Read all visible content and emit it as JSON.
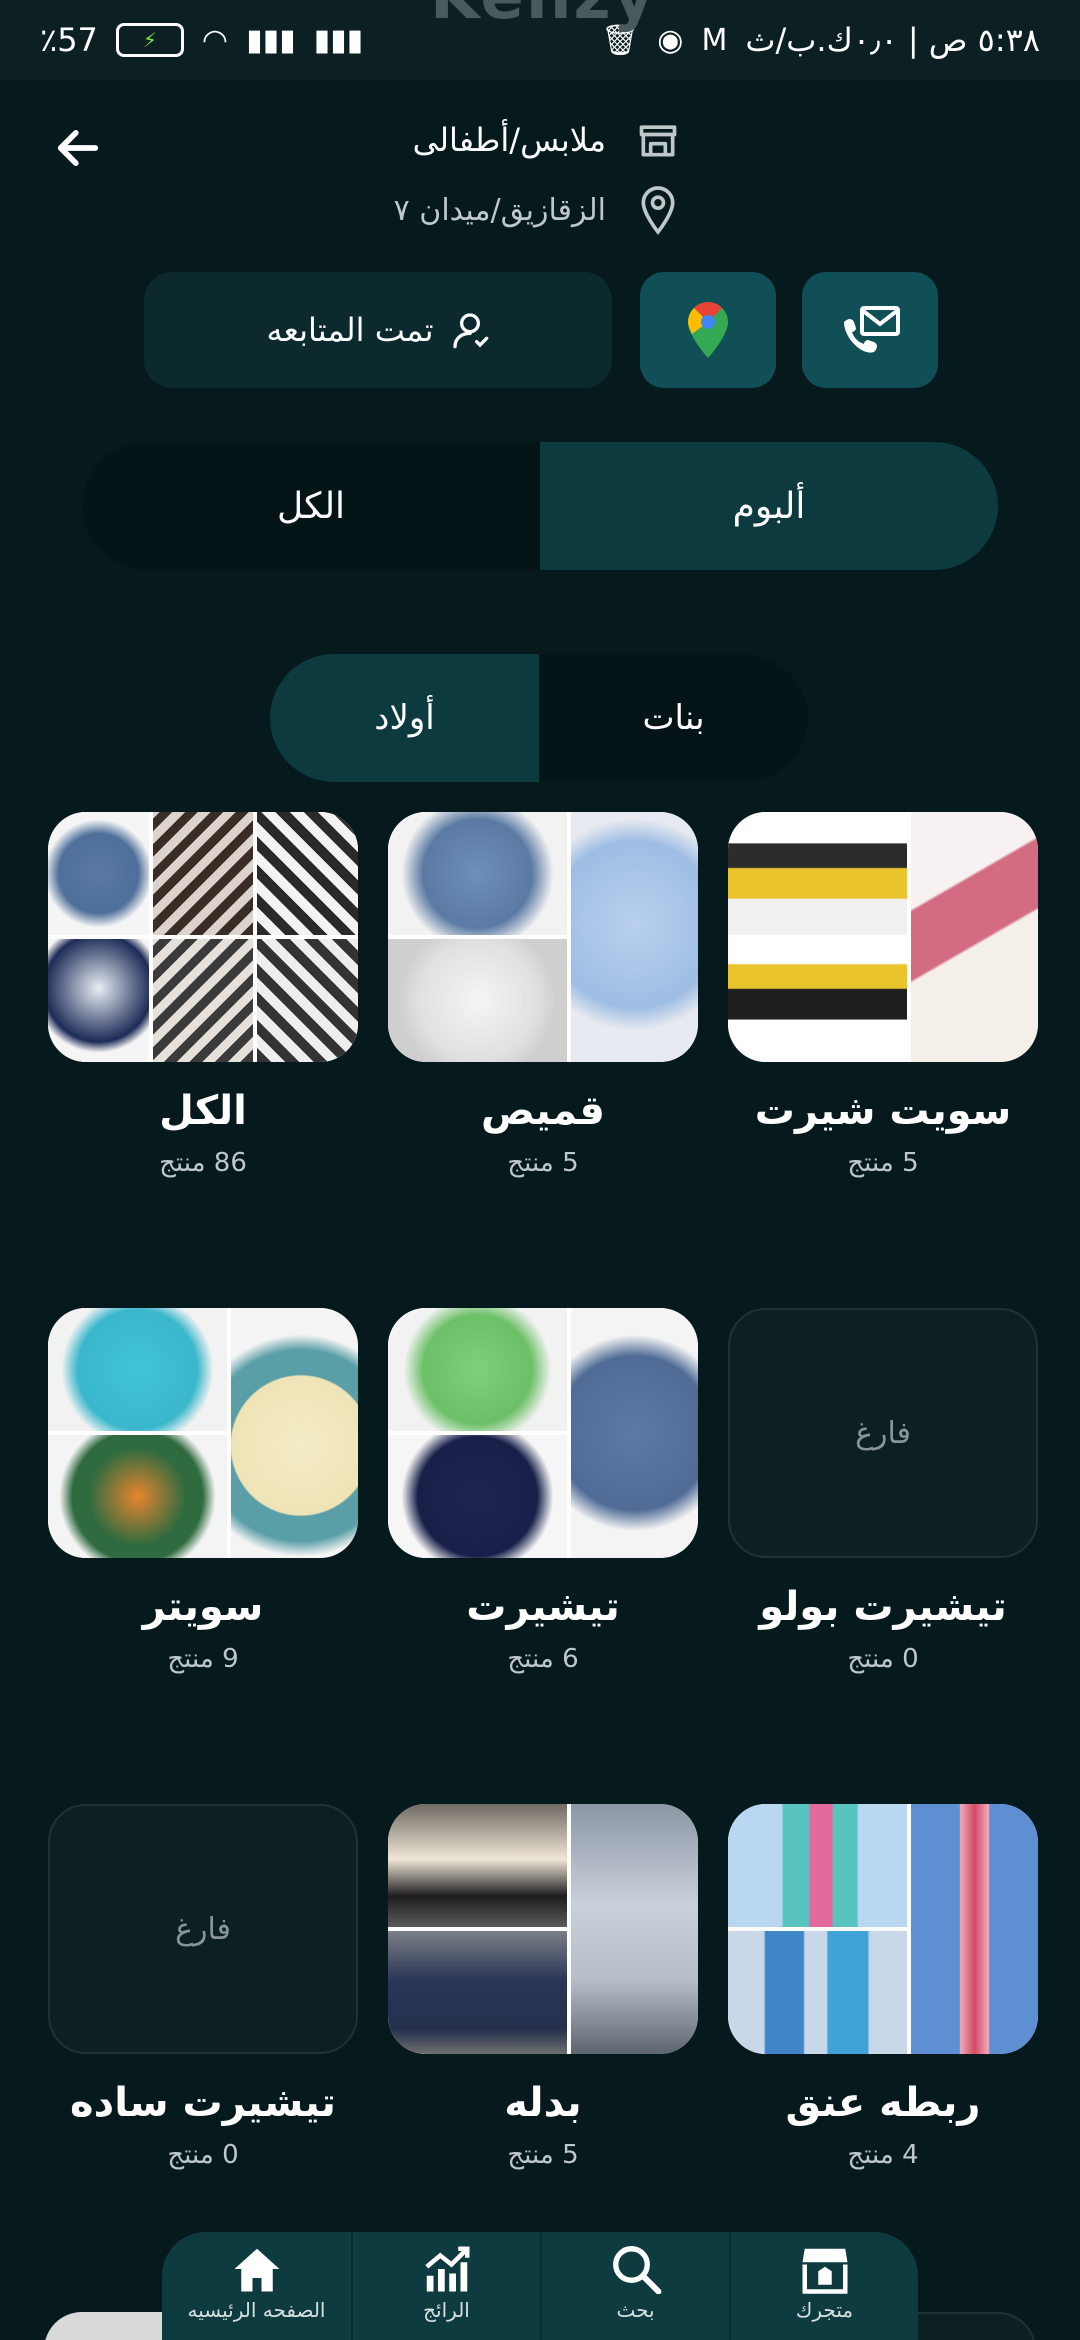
{
  "status_bar": {
    "time": "٥:٣٨ ص | ٠٫٠ك.ب/ث",
    "battery": "٪57"
  },
  "app_title_ghost": "Kenzy",
  "store": {
    "category": "ملابس/أطفالى",
    "location": "الزقازيق/ميدان ٧"
  },
  "actions": {
    "follow_label": "تمت المتابعه"
  },
  "main_tabs": [
    {
      "label": "ألبوم",
      "active": true
    },
    {
      "label": "الكل",
      "active": false
    }
  ],
  "sub_tabs": [
    {
      "label": "بنات",
      "active": false
    },
    {
      "label": "أولاد",
      "active": true
    }
  ],
  "categories": [
    {
      "title": "سويت شيرت",
      "count": "5 منتج",
      "empty": false
    },
    {
      "title": "قميص",
      "count": "5 منتج",
      "empty": false
    },
    {
      "title": "الكل",
      "count": "86 منتج",
      "empty": false
    },
    {
      "title": "تيشيرت بولو",
      "count": "0 منتج",
      "empty": true,
      "empty_label": "فارغ"
    },
    {
      "title": "تيشيرت",
      "count": "6 منتج",
      "empty": false
    },
    {
      "title": "سويتر",
      "count": "9 منتج",
      "empty": false
    },
    {
      "title": "ربطه عنق",
      "count": "4 منتج",
      "empty": false
    },
    {
      "title": "بدله",
      "count": "5 منتج",
      "empty": false
    },
    {
      "title": "تيشيرت ساده",
      "count": "0 منتج",
      "empty": true,
      "empty_label": "فارغ"
    }
  ],
  "bottom_nav": [
    {
      "label": "الصفحه الرئيسيه",
      "icon": "home-icon"
    },
    {
      "label": "الرائج",
      "icon": "trending-chart-icon"
    },
    {
      "label": "بحث",
      "icon": "search-icon"
    },
    {
      "label": "متجرك",
      "icon": "store-icon"
    }
  ],
  "colors": {
    "background": "#061a1e",
    "accent": "#0f4f55",
    "nav": "#0d3b40"
  }
}
